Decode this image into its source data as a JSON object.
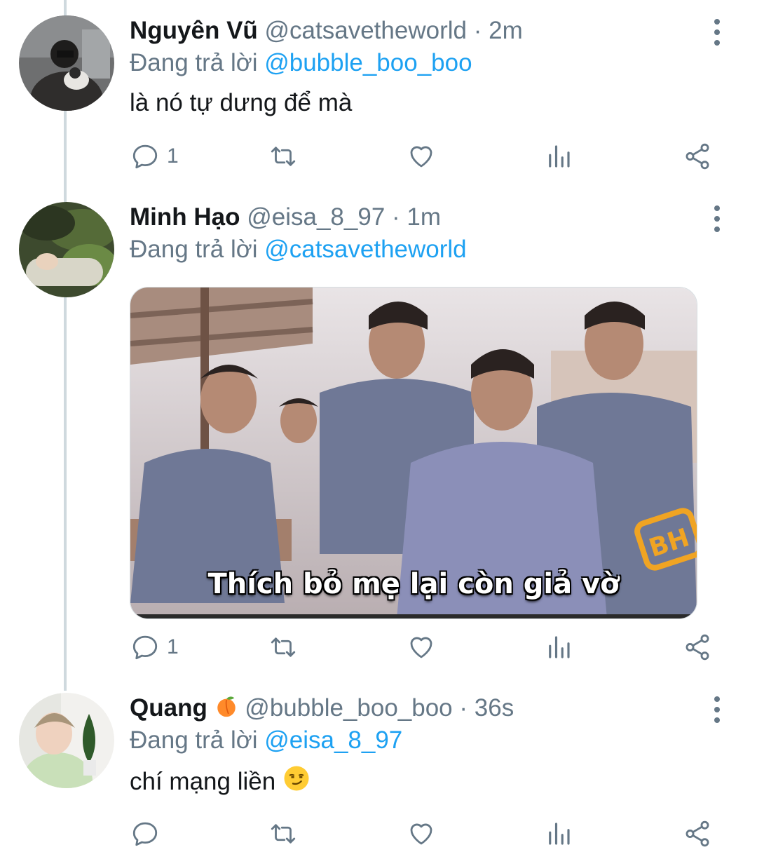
{
  "tweets": [
    {
      "name": "Nguyên Vũ",
      "handle": "@catsavetheworld",
      "time": "2m",
      "reply_prefix": "Đang trả lời",
      "reply_to": "@bubble_boo_boo",
      "text": "là nó tự dưng để mà",
      "reply_count": "1"
    },
    {
      "name": "Minh Hạo",
      "handle": "@eisa_8_97",
      "time": "1m",
      "reply_prefix": "Đang trả lời",
      "reply_to": "@catsavetheworld",
      "media_caption": "Thích bỏ mẹ lại còn giả vờ",
      "media_watermark": "BH",
      "reply_count": "1"
    },
    {
      "name": "Quang",
      "name_emoji": "peach-emoji",
      "handle": "@bubble_boo_boo",
      "time": "36s",
      "reply_prefix": "Đang trả lời",
      "reply_to": "@eisa_8_97",
      "text": "chí mạng liền",
      "text_emoji": "smirking-face-emoji",
      "reply_count": ""
    }
  ],
  "separator": "·",
  "icons": [
    "reply-icon",
    "retweet-icon",
    "like-icon",
    "analytics-icon",
    "share-icon",
    "more-options-icon"
  ],
  "colors": {
    "link": "#1da1f2",
    "secondary": "#657786",
    "primary_text": "#14171a",
    "thread_line": "#cfd9de"
  }
}
